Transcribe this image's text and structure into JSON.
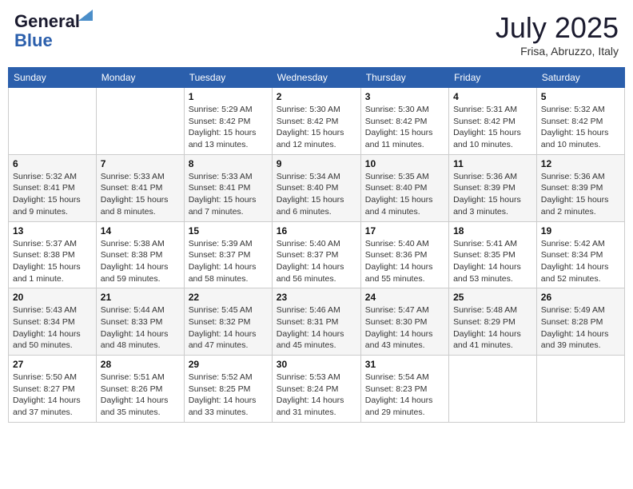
{
  "header": {
    "logo_line1": "General",
    "logo_line2": "Blue",
    "month": "July 2025",
    "location": "Frisa, Abruzzo, Italy"
  },
  "days_of_week": [
    "Sunday",
    "Monday",
    "Tuesday",
    "Wednesday",
    "Thursday",
    "Friday",
    "Saturday"
  ],
  "weeks": [
    [
      {
        "day": "",
        "detail": ""
      },
      {
        "day": "",
        "detail": ""
      },
      {
        "day": "1",
        "detail": "Sunrise: 5:29 AM\nSunset: 8:42 PM\nDaylight: 15 hours and 13 minutes."
      },
      {
        "day": "2",
        "detail": "Sunrise: 5:30 AM\nSunset: 8:42 PM\nDaylight: 15 hours and 12 minutes."
      },
      {
        "day": "3",
        "detail": "Sunrise: 5:30 AM\nSunset: 8:42 PM\nDaylight: 15 hours and 11 minutes."
      },
      {
        "day": "4",
        "detail": "Sunrise: 5:31 AM\nSunset: 8:42 PM\nDaylight: 15 hours and 10 minutes."
      },
      {
        "day": "5",
        "detail": "Sunrise: 5:32 AM\nSunset: 8:42 PM\nDaylight: 15 hours and 10 minutes."
      }
    ],
    [
      {
        "day": "6",
        "detail": "Sunrise: 5:32 AM\nSunset: 8:41 PM\nDaylight: 15 hours and 9 minutes."
      },
      {
        "day": "7",
        "detail": "Sunrise: 5:33 AM\nSunset: 8:41 PM\nDaylight: 15 hours and 8 minutes."
      },
      {
        "day": "8",
        "detail": "Sunrise: 5:33 AM\nSunset: 8:41 PM\nDaylight: 15 hours and 7 minutes."
      },
      {
        "day": "9",
        "detail": "Sunrise: 5:34 AM\nSunset: 8:40 PM\nDaylight: 15 hours and 6 minutes."
      },
      {
        "day": "10",
        "detail": "Sunrise: 5:35 AM\nSunset: 8:40 PM\nDaylight: 15 hours and 4 minutes."
      },
      {
        "day": "11",
        "detail": "Sunrise: 5:36 AM\nSunset: 8:39 PM\nDaylight: 15 hours and 3 minutes."
      },
      {
        "day": "12",
        "detail": "Sunrise: 5:36 AM\nSunset: 8:39 PM\nDaylight: 15 hours and 2 minutes."
      }
    ],
    [
      {
        "day": "13",
        "detail": "Sunrise: 5:37 AM\nSunset: 8:38 PM\nDaylight: 15 hours and 1 minute."
      },
      {
        "day": "14",
        "detail": "Sunrise: 5:38 AM\nSunset: 8:38 PM\nDaylight: 14 hours and 59 minutes."
      },
      {
        "day": "15",
        "detail": "Sunrise: 5:39 AM\nSunset: 8:37 PM\nDaylight: 14 hours and 58 minutes."
      },
      {
        "day": "16",
        "detail": "Sunrise: 5:40 AM\nSunset: 8:37 PM\nDaylight: 14 hours and 56 minutes."
      },
      {
        "day": "17",
        "detail": "Sunrise: 5:40 AM\nSunset: 8:36 PM\nDaylight: 14 hours and 55 minutes."
      },
      {
        "day": "18",
        "detail": "Sunrise: 5:41 AM\nSunset: 8:35 PM\nDaylight: 14 hours and 53 minutes."
      },
      {
        "day": "19",
        "detail": "Sunrise: 5:42 AM\nSunset: 8:34 PM\nDaylight: 14 hours and 52 minutes."
      }
    ],
    [
      {
        "day": "20",
        "detail": "Sunrise: 5:43 AM\nSunset: 8:34 PM\nDaylight: 14 hours and 50 minutes."
      },
      {
        "day": "21",
        "detail": "Sunrise: 5:44 AM\nSunset: 8:33 PM\nDaylight: 14 hours and 48 minutes."
      },
      {
        "day": "22",
        "detail": "Sunrise: 5:45 AM\nSunset: 8:32 PM\nDaylight: 14 hours and 47 minutes."
      },
      {
        "day": "23",
        "detail": "Sunrise: 5:46 AM\nSunset: 8:31 PM\nDaylight: 14 hours and 45 minutes."
      },
      {
        "day": "24",
        "detail": "Sunrise: 5:47 AM\nSunset: 8:30 PM\nDaylight: 14 hours and 43 minutes."
      },
      {
        "day": "25",
        "detail": "Sunrise: 5:48 AM\nSunset: 8:29 PM\nDaylight: 14 hours and 41 minutes."
      },
      {
        "day": "26",
        "detail": "Sunrise: 5:49 AM\nSunset: 8:28 PM\nDaylight: 14 hours and 39 minutes."
      }
    ],
    [
      {
        "day": "27",
        "detail": "Sunrise: 5:50 AM\nSunset: 8:27 PM\nDaylight: 14 hours and 37 minutes."
      },
      {
        "day": "28",
        "detail": "Sunrise: 5:51 AM\nSunset: 8:26 PM\nDaylight: 14 hours and 35 minutes."
      },
      {
        "day": "29",
        "detail": "Sunrise: 5:52 AM\nSunset: 8:25 PM\nDaylight: 14 hours and 33 minutes."
      },
      {
        "day": "30",
        "detail": "Sunrise: 5:53 AM\nSunset: 8:24 PM\nDaylight: 14 hours and 31 minutes."
      },
      {
        "day": "31",
        "detail": "Sunrise: 5:54 AM\nSunset: 8:23 PM\nDaylight: 14 hours and 29 minutes."
      },
      {
        "day": "",
        "detail": ""
      },
      {
        "day": "",
        "detail": ""
      }
    ]
  ]
}
